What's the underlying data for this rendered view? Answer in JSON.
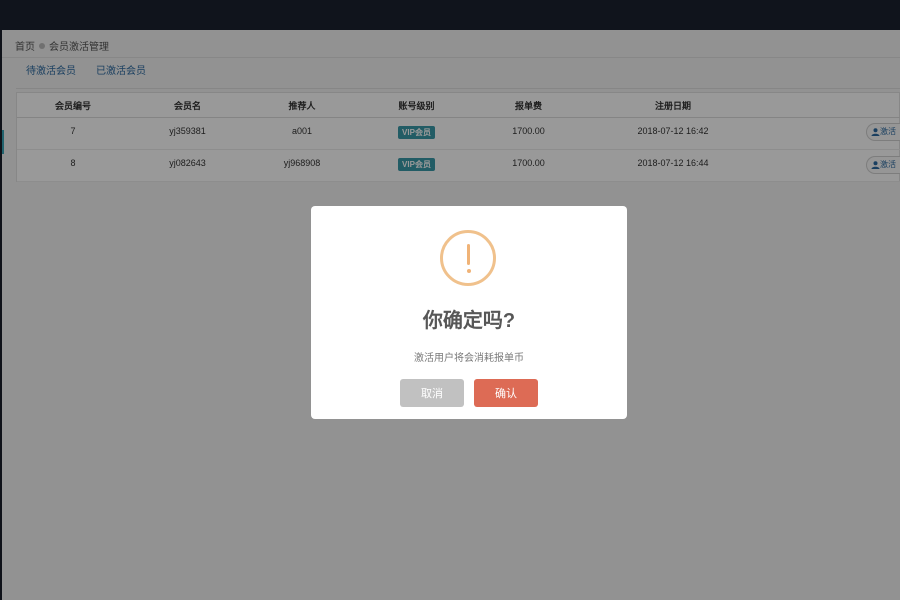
{
  "breadcrumb": {
    "home": "首页",
    "current": "会员激活管理"
  },
  "tabs": [
    {
      "label": "待激活会员"
    },
    {
      "label": "已激活会员"
    }
  ],
  "table": {
    "headers": [
      "会员编号",
      "会员名",
      "推荐人",
      "账号级别",
      "报单费",
      "注册日期"
    ],
    "rows": [
      {
        "id": "7",
        "name": "yj359381",
        "referrer": "a001",
        "level": "VIP会员",
        "fee": "1700.00",
        "date": "2018-07-12 16:42",
        "action": "激活"
      },
      {
        "id": "8",
        "name": "yj082643",
        "referrer": "yj968908",
        "level": "VIP会员",
        "fee": "1700.00",
        "date": "2018-07-12 16:44",
        "action": "激活"
      }
    ]
  },
  "modal": {
    "title": "你确定吗?",
    "text": "激活用户将会消耗报单币",
    "cancel_label": "取消",
    "confirm_label": "确认"
  },
  "colors": {
    "accent": "#3a9aa8",
    "warning": "#f0b377",
    "confirm": "#dd6b55",
    "cancel": "#c1c1c1"
  }
}
